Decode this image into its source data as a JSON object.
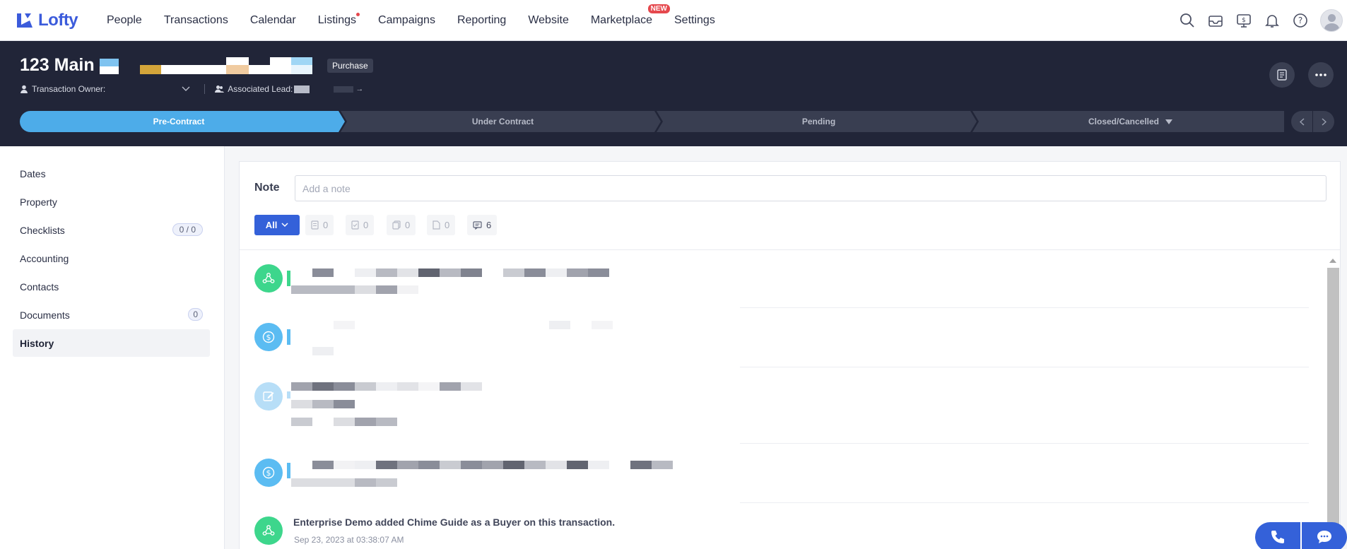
{
  "nav": {
    "brand": "Lofty",
    "items": [
      {
        "label": "People"
      },
      {
        "label": "Transactions"
      },
      {
        "label": "Calendar"
      },
      {
        "label": "Listings",
        "dot": true
      },
      {
        "label": "Campaigns"
      },
      {
        "label": "Reporting"
      },
      {
        "label": "Website"
      },
      {
        "label": "Marketplace",
        "badge": "NEW"
      },
      {
        "label": "Settings"
      }
    ],
    "icons": [
      "search-icon",
      "inbox-icon",
      "billing-icon",
      "bell-icon",
      "help-icon",
      "avatar"
    ]
  },
  "transaction": {
    "title": "123 Main",
    "type_tag": "Purchase",
    "owner_label": "Transaction Owner:",
    "lead_label": "Associated Lead:"
  },
  "pipeline": {
    "stages": [
      "Pre-Contract",
      "Under Contract",
      "Pending",
      "Closed/Cancelled"
    ],
    "active_index": 0,
    "colors": {
      "active": "#4dace9",
      "inactive": "#393e51"
    }
  },
  "sidebar": {
    "items": [
      {
        "label": "Dates"
      },
      {
        "label": "Property"
      },
      {
        "label": "Checklists",
        "badge": "0 / 0"
      },
      {
        "label": "Accounting"
      },
      {
        "label": "Contacts"
      },
      {
        "label": "Documents",
        "badge": "0"
      },
      {
        "label": "History",
        "active": true
      }
    ]
  },
  "main": {
    "note_label": "Note",
    "note_placeholder": "Add a note",
    "filters": {
      "all_label": "All",
      "counts": [
        "0",
        "0",
        "0",
        "0",
        "6"
      ]
    },
    "history": {
      "last_entry_text": "Enterprise Demo added Chime Guide as a Buyer on this transaction.",
      "last_entry_date": "Sep 23, 2023 at 03:38:07 AM"
    }
  },
  "colors": {
    "accent": "#3461d9",
    "header_bg": "#212538",
    "green": "#3dd68c",
    "blue": "#5bbcf2"
  }
}
